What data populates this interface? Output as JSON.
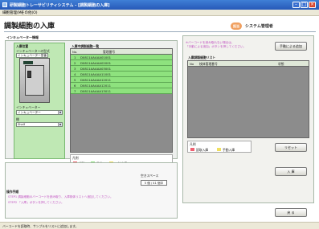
{
  "window": {
    "title": "研製細胞トレーサビリティシステム - [調製細胞の入庫]",
    "min_glyph": "–",
    "max_glyph": "□",
    "close_glyph": "×"
  },
  "menu": [
    "細胞管理(M)",
    "その他(O)"
  ],
  "page": {
    "title": "調製細胞の入庫",
    "user_badge": "担当",
    "user_name": "システム管理者"
  },
  "incubator_info": {
    "heading": "インキュベーター情報",
    "storage_location_label": "入庫位置",
    "incubator_type_label": "インキュベーターの型式",
    "incubator_type_value": "インキュベーター型番",
    "incubator_label": "インキュベーター",
    "incubator_value": "インキュベーター",
    "shelf_label": "棚",
    "shelf_value": "Shelf"
  },
  "storage_list": {
    "heading": "入庫中調製細胞一覧",
    "columns": [
      "No.",
      "管理番号"
    ],
    "rows": [
      {
        "no": "1",
        "id": "D0811AAAAA01001"
      },
      {
        "no": "2",
        "id": "D0811AAAAA02001"
      },
      {
        "no": "3",
        "id": "D0811AAAAA03001"
      },
      {
        "no": "4",
        "id": "D0811AAAAA11001"
      },
      {
        "no": "5",
        "id": "D0811AAAAA12011"
      },
      {
        "no": "6",
        "id": "D0811AAAAA12011"
      },
      {
        "no": "7",
        "id": "D0811AAAAA13011"
      }
    ],
    "legend_title": "凡例",
    "legend": [
      {
        "label": "調製",
        "color": "#f06070"
      },
      {
        "label": "予備",
        "color": "#8ee27e"
      },
      {
        "label": "一時出庫",
        "color": "#f0e060"
      }
    ],
    "free_space_label": "空きスペース",
    "free_space_value": "5 個 / 41 個中"
  },
  "instructions": {
    "heading": "操作手順",
    "steps": [
      "STEP1 調製細胞のバーコードを読み取り、入庫検体リストへ追加してください。",
      "STEP2 「入庫」ボタンを押してください。"
    ]
  },
  "stock_in": {
    "heading": "調製細胞の入庫操作",
    "notice_1": "※バーコードを読み取れない場合は、",
    "notice_2": "「手動による追加」ボタンを押してください。",
    "manual_add_button": "手動による追加",
    "list_heading": "入庫調製細胞リスト",
    "list_columns": [
      "No",
      "検体管理番号",
      "状態"
    ],
    "legend_title": "凡例",
    "legend": [
      {
        "label": "読取入庫",
        "color": "#f06070"
      },
      {
        "label": "手動入庫",
        "color": "#f0e060"
      }
    ],
    "reset_button": "リセット",
    "stock_in_button": "入 庫",
    "back_button": "戻 る"
  },
  "status_bar": "バーコードを読取時、サンプルをリストに追加します。"
}
